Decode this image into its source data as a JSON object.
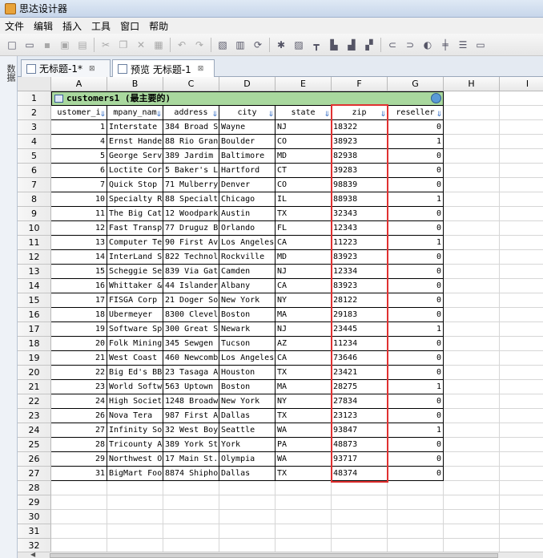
{
  "window": {
    "title": "思达设计器"
  },
  "menu": [
    "文件",
    "编辑",
    "插入",
    "工具",
    "窗口",
    "帮助"
  ],
  "toolbar": {
    "icons": [
      "new-icon",
      "open-icon",
      "save-icon",
      "save-as-icon",
      "copy-sheet-icon",
      "sep",
      "cut-icon",
      "copy-icon",
      "delete-icon",
      "paste-icon",
      "sep",
      "undo-icon",
      "redo-icon",
      "sep",
      "preview-icon",
      "table-icon",
      "refresh-icon",
      "sep",
      "tool-1-icon",
      "tool-2-icon",
      "tool-3-icon",
      "tool-4-icon",
      "tool-5-icon",
      "tool-6-icon",
      "sep",
      "tool-7-icon",
      "tool-8-icon",
      "tool-9-icon",
      "tool-10-icon",
      "tool-11-icon",
      "tool-12-icon"
    ]
  },
  "left_panel": {
    "label": "数据"
  },
  "tabs": [
    {
      "label": "无标题-1*",
      "close": "⊠",
      "active": false
    },
    {
      "label": "预览 无标题-1",
      "close": "⊠",
      "active": true
    }
  ],
  "grid": {
    "columns": [
      "A",
      "B",
      "C",
      "D",
      "E",
      "F",
      "G",
      "H",
      "I"
    ],
    "row_numbers": [
      "1",
      "2",
      "3",
      "4",
      "5",
      "6",
      "7",
      "8",
      "9",
      "10",
      "11",
      "12",
      "13",
      "14",
      "15",
      "16",
      "17",
      "18",
      "19",
      "20",
      "21",
      "22",
      "23",
      "24",
      "25",
      "26",
      "27",
      "28",
      "29",
      "30",
      "31",
      "32"
    ],
    "table_title": "customers1 (最主要的)",
    "headers": [
      "ustomer_i",
      "mpany_nam",
      "address",
      "city",
      "state",
      "zip",
      "reseller"
    ],
    "rows": [
      [
        "1",
        "Interstate",
        "384 Broad S",
        "Wayne",
        "NJ",
        "18322",
        "0"
      ],
      [
        "4",
        "Ernst Hande",
        "88 Rio Gran",
        "Boulder",
        "CO",
        "38923",
        "1"
      ],
      [
        "5",
        "George Serv",
        "389 Jardim",
        "Baltimore",
        "MD",
        "82938",
        "0"
      ],
      [
        "6",
        "Loctite Cor",
        "5 Baker's L",
        "Hartford",
        "CT",
        "39283",
        "0"
      ],
      [
        "7",
        "Quick Stop",
        "71 Mulberry",
        "Denver",
        "CO",
        "98839",
        "0"
      ],
      [
        "10",
        "Specialty R",
        "88 Specialt",
        "Chicago",
        "IL",
        "88938",
        "1"
      ],
      [
        "11",
        "The Big Cat",
        "12 Woodpark",
        "Austin",
        "TX",
        "32343",
        "0"
      ],
      [
        "12",
        "Fast Transp",
        "77 Druguz B",
        "Orlando",
        "FL",
        "12343",
        "0"
      ],
      [
        "13",
        "Computer Te",
        "90 First Av",
        "Los Angeles",
        "CA",
        "11223",
        "1"
      ],
      [
        "14",
        "InterLand S",
        "822 Technol",
        "Rockville",
        "MD",
        "83923",
        "0"
      ],
      [
        "15",
        "Scheggie Se",
        "839 Via Gat",
        "Camden",
        "NJ",
        "12334",
        "0"
      ],
      [
        "16",
        "Whittaker &",
        "44 Islander",
        "Albany",
        "CA",
        "83923",
        "0"
      ],
      [
        "17",
        "FISGA Corp",
        "21 Doger So",
        "New York",
        "NY",
        "28122",
        "0"
      ],
      [
        "18",
        "Ubermeyer",
        "8300 Clevel",
        "Boston",
        "MA",
        "29183",
        "0"
      ],
      [
        "19",
        "Software Sp",
        "300 Great S",
        "Newark",
        "NJ",
        "23445",
        "1"
      ],
      [
        "20",
        "Folk Mining",
        "345 Sewgen",
        "Tucson",
        "AZ",
        "11234",
        "0"
      ],
      [
        "21",
        "West Coast",
        "460 Newcomb",
        "Los Angeles",
        "CA",
        "73646",
        "0"
      ],
      [
        "22",
        "Big Ed's BB",
        "23 Tasaga A",
        "Houston",
        "TX",
        "23421",
        "0"
      ],
      [
        "23",
        "World Softw",
        "563 Uptown",
        "Boston",
        "MA",
        "28275",
        "1"
      ],
      [
        "24",
        "High Societ",
        "1248 Broadw",
        "New York",
        "NY",
        "27834",
        "0"
      ],
      [
        "26",
        "Nova Tera",
        "987 First A",
        "Dallas",
        "TX",
        "23123",
        "0"
      ],
      [
        "27",
        "Infinity So",
        "32 West Boy",
        "Seattle",
        "WA",
        "93847",
        "1"
      ],
      [
        "28",
        "Tricounty A",
        "389 York St",
        "York",
        "PA",
        "48873",
        "0"
      ],
      [
        "29",
        "Northwest O",
        "17 Main St.",
        "Olympia",
        "WA",
        "93717",
        "0"
      ],
      [
        "31",
        "BigMart Foo",
        "8874 Shipho",
        "Dallas",
        "TX",
        "48374",
        "0"
      ]
    ]
  },
  "highlight": {
    "column": "zip",
    "color": "#e03131"
  }
}
